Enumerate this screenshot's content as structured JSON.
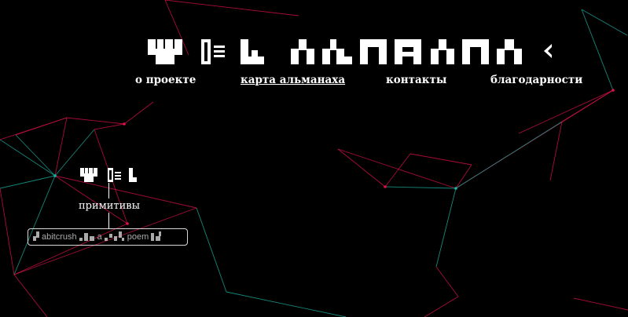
{
  "header": {
    "logo_text": "W≡L ALMANAC",
    "logo_color": "#ffffff"
  },
  "nav": {
    "items": [
      {
        "label": "о проекте",
        "active": false
      },
      {
        "label": "карта альманаха",
        "active": true
      },
      {
        "label": "контакты",
        "active": false
      },
      {
        "label": "благодарности",
        "active": false
      }
    ]
  },
  "map_node": {
    "logo_text": "W≡L",
    "label": "примитивы",
    "tags": [
      "abitcrush",
      "a",
      "poem"
    ]
  },
  "colors": {
    "background": "#000000",
    "line_red": "#e0104a",
    "line_teal": "#1bb3a3",
    "text": "#ffffff",
    "tag_border": "#d8d8d8",
    "tag_text": "#aaaaaa"
  },
  "icons": [
    "pixel-logo-icon",
    "chevron-left-icon",
    "pixel-glyph-icon"
  ]
}
